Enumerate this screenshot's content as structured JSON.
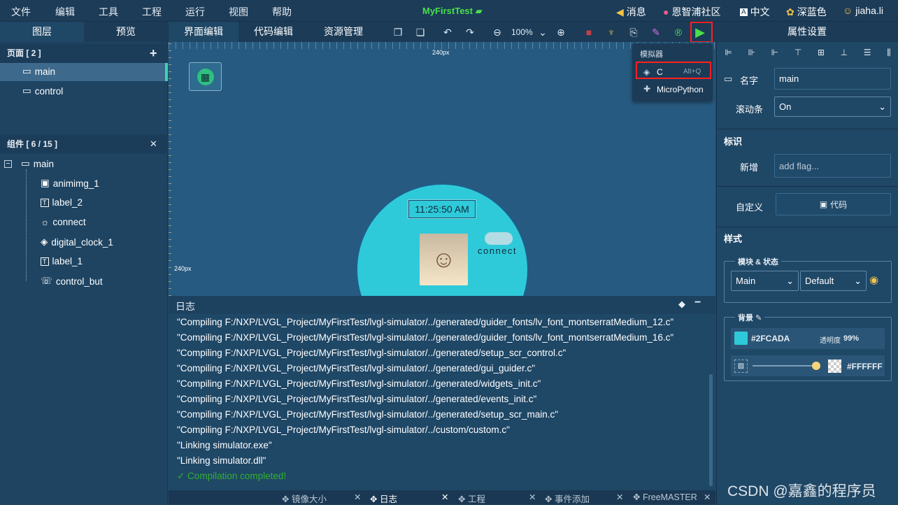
{
  "menubar": {
    "items": [
      "文件",
      "编辑",
      "工具",
      "工程",
      "运行",
      "视图",
      "帮助"
    ],
    "project_title": "MyFirstTest",
    "messages_label": "消息",
    "community_label": "恩智浦社区",
    "language_label": "中文",
    "theme_label": "深蓝色",
    "user_label": "jiaha.li"
  },
  "left_tabs": {
    "layers": "图层",
    "preview": "预览"
  },
  "center_tabs": {
    "ui_edit": "界面编辑",
    "code_edit": "代码编辑",
    "resources": "资源管理"
  },
  "toolbar": {
    "zoom": "100%"
  },
  "pages": {
    "header": "页面 [ 2 ]",
    "items": [
      "main",
      "control"
    ]
  },
  "components": {
    "header": "组件 [ 6 / 15 ]",
    "root": "main",
    "items": [
      "animimg_1",
      "label_2",
      "connect",
      "digital_clock_1",
      "label_1",
      "control_but"
    ]
  },
  "canvas": {
    "ruler_top_label": "240px",
    "ruler_left_label": "240px",
    "clock_text": "11:25:50 AM",
    "connect_text": "connect"
  },
  "simulator_menu": {
    "title": "模拟器",
    "c_label": "C",
    "c_shortcut": "Alt+Q",
    "mp_label": "MicroPython"
  },
  "log": {
    "title": "日志",
    "lines": [
      "\"Compiling F:/NXP/LVGL_Project/MyFirstTest/lvgl-simulator/../generated/guider_fonts/lv_font_montserratMedium_12.c\"",
      "\"Compiling F:/NXP/LVGL_Project/MyFirstTest/lvgl-simulator/../generated/guider_fonts/lv_font_montserratMedium_16.c\"",
      "\"Compiling F:/NXP/LVGL_Project/MyFirstTest/lvgl-simulator/../generated/setup_scr_control.c\"",
      "\"Compiling F:/NXP/LVGL_Project/MyFirstTest/lvgl-simulator/../generated/gui_guider.c\"",
      "\"Compiling F:/NXP/LVGL_Project/MyFirstTest/lvgl-simulator/../generated/widgets_init.c\"",
      "\"Compiling F:/NXP/LVGL_Project/MyFirstTest/lvgl-simulator/../generated/events_init.c\"",
      "\"Compiling F:/NXP/LVGL_Project/MyFirstTest/lvgl-simulator/../generated/setup_scr_main.c\"",
      "\"Compiling F:/NXP/LVGL_Project/MyFirstTest/lvgl-simulator/../custom/custom.c\"",
      "\"Linking simulator.exe\"",
      "\"Linking simulator.dll\""
    ],
    "completed": "✓ Compilation completed!"
  },
  "bottom_tabs": [
    "镜像大小",
    "日志",
    "工程",
    "事件添加",
    "FreeMASTER"
  ],
  "properties": {
    "title": "属性设置",
    "name_label": "名字",
    "name_value": "main",
    "scrollbar_label": "滚动条",
    "scrollbar_value": "On",
    "flags_section": "标识",
    "add_label": "新增",
    "add_placeholder": "add flag...",
    "custom_label": "自定义",
    "code_button": "代码",
    "style_section": "样式",
    "module_state_label": "模块 & 状态",
    "part_value": "Main",
    "state_value": "Default",
    "bg_label": "背景",
    "bg_color": "#2FCADA",
    "opacity_label": "透明度",
    "opacity_value": "99%",
    "bg_image_color": "#FFFFFF"
  },
  "watermark": "CSDN @嘉鑫的程序员",
  "colors": {
    "accent_green": "#49e04a",
    "highlight_red": "#ff2020",
    "bg_swatch": "#2FCADA"
  }
}
